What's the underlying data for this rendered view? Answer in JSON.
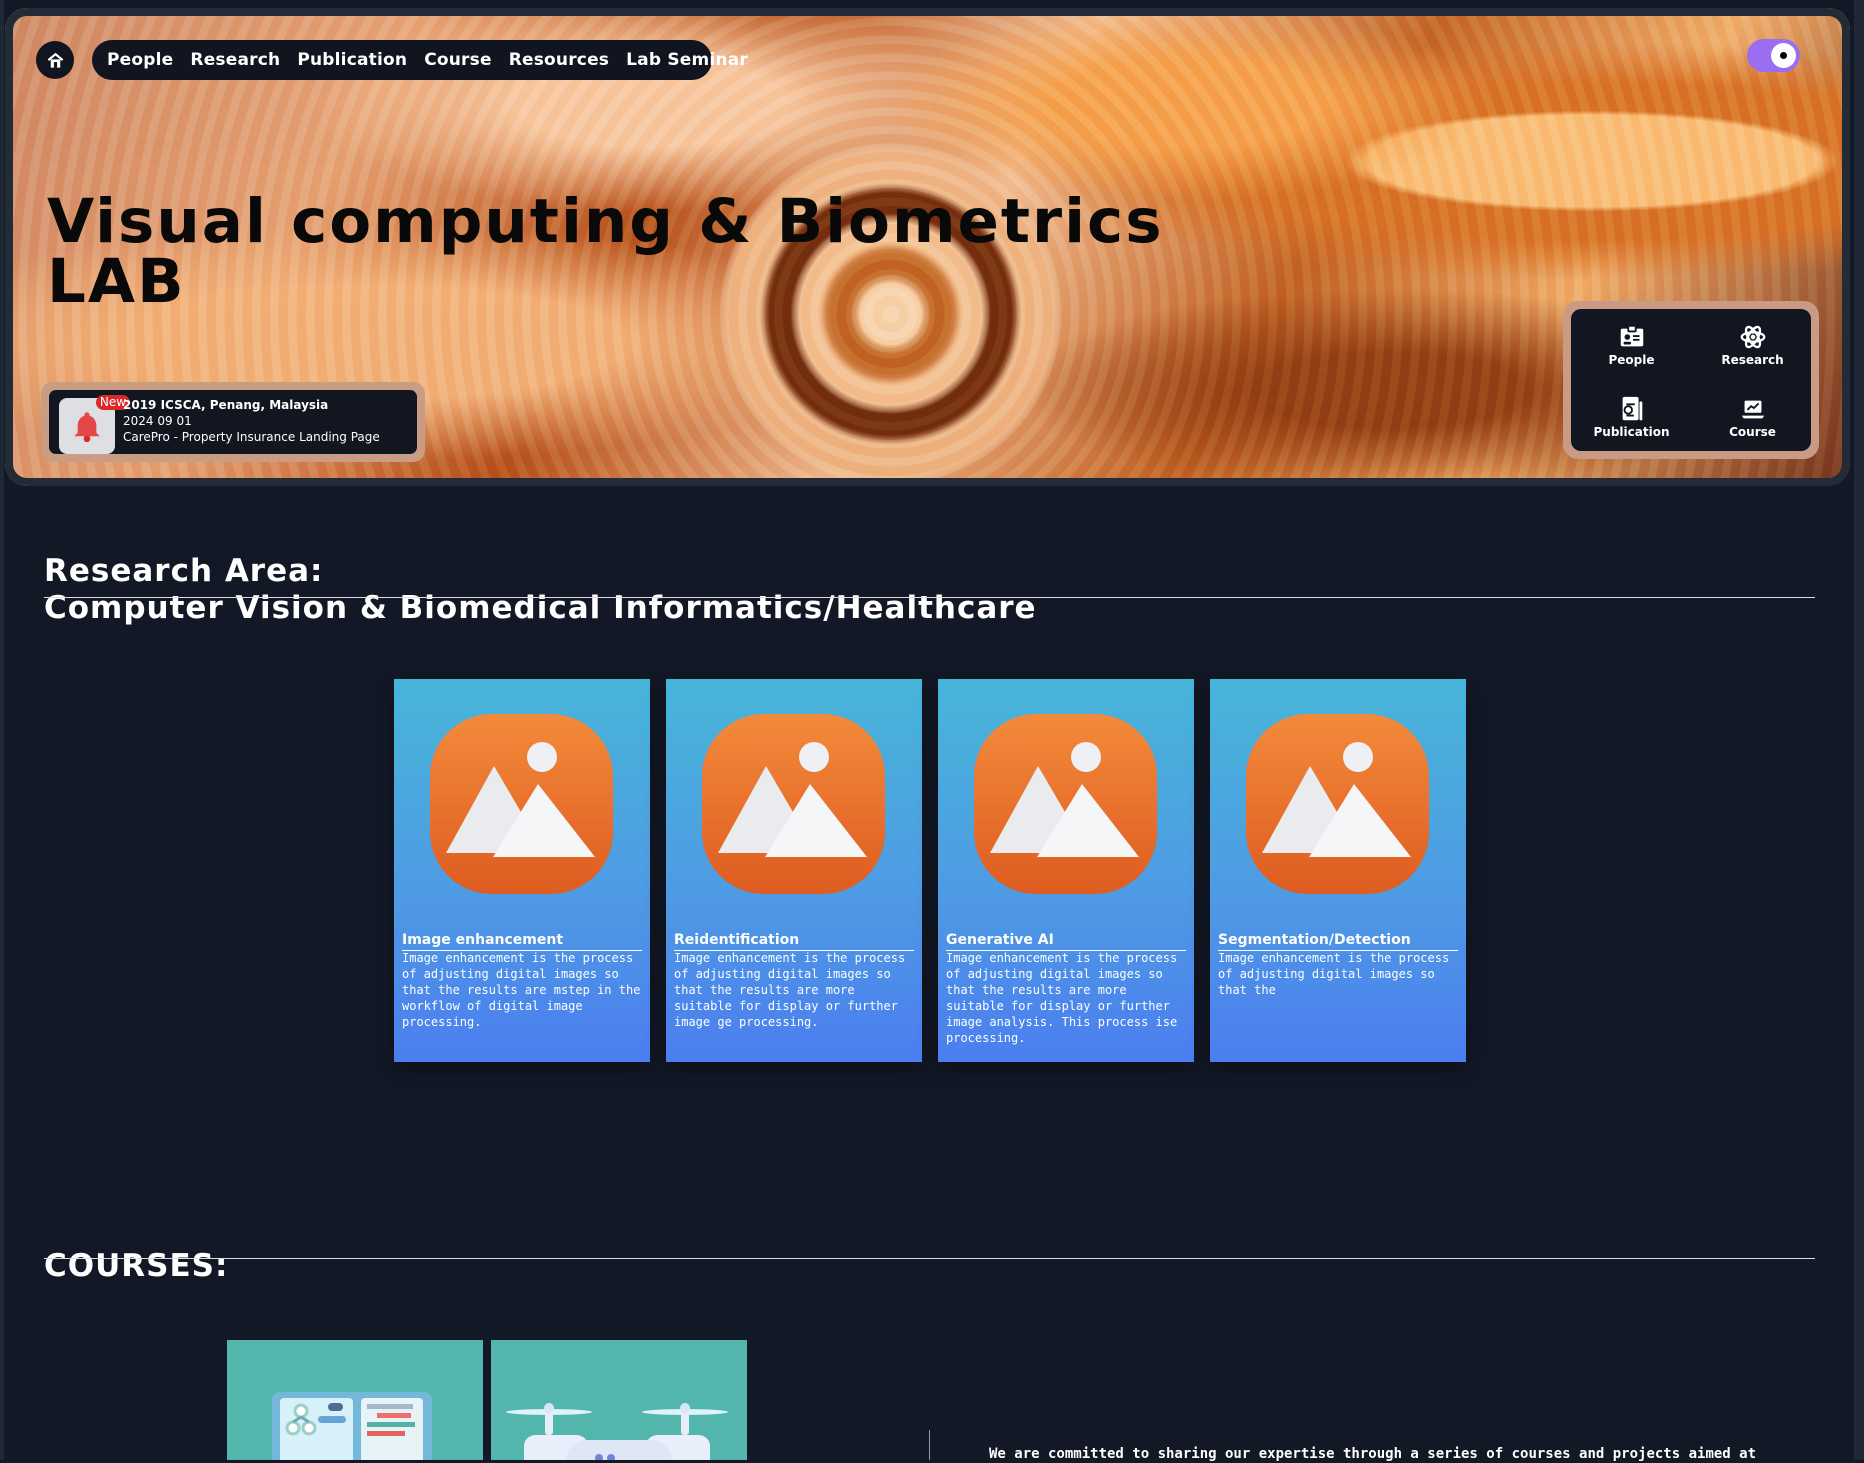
{
  "nav": {
    "home_icon": "home-icon",
    "items": [
      "People",
      "Research",
      "Publication",
      "Course",
      "Resources",
      "Lab Seminar"
    ]
  },
  "theme_toggle": {
    "state": "on",
    "accent_color": "#9b6df0"
  },
  "hero": {
    "title_line_1": "Visual computing & Biometrics",
    "title_line_2": "LAB",
    "background_theme": "orange abstract swirl"
  },
  "notice": {
    "badge": "New",
    "icon": "bell-icon",
    "line_1": "2019 ICSCA, Penang, Malaysia",
    "line_2": "2024 09 01",
    "line_3": "CarePro - Property Insurance Landing Page"
  },
  "quick_links": [
    {
      "label": "People",
      "icon": "id-card-icon"
    },
    {
      "label": "Research",
      "icon": "atom-icon"
    },
    {
      "label": "Publication",
      "icon": "document-icon"
    },
    {
      "label": "Course",
      "icon": "laptop-chart-icon"
    }
  ],
  "research": {
    "heading_line_1": "Research Area:",
    "heading_line_2": "Computer Vision & Biomedical Informatics/Healthcare",
    "cards": [
      {
        "title": "Image enhancement",
        "description": "Image enhancement is the process of adjusting digital images so that the results are mstep in the workflow of digital image processing."
      },
      {
        "title": "Reidentification",
        "description": "Image enhancement is the process of adjusting digital images so that the results are more suitable for display or further image ge processing."
      },
      {
        "title": "Generative AI",
        "description": "Image enhancement is the process of adjusting digital images so that the results are more suitable for display or further image analysis. This process ise processing."
      },
      {
        "title": "Segmentation/Detection",
        "description": "Image enhancement is the process of adjusting digital images so that the"
      }
    ]
  },
  "courses": {
    "heading": "COURSES:",
    "intro": "We are committed to sharing our expertise through a series of courses and projects aimed at"
  },
  "colors": {
    "page_background": "#121826",
    "panel_dark": "#111620",
    "card_gradient_top": "#48b5d9",
    "card_gradient_bottom": "#4b7ef0",
    "image_icon_orange": "#e9752f"
  }
}
